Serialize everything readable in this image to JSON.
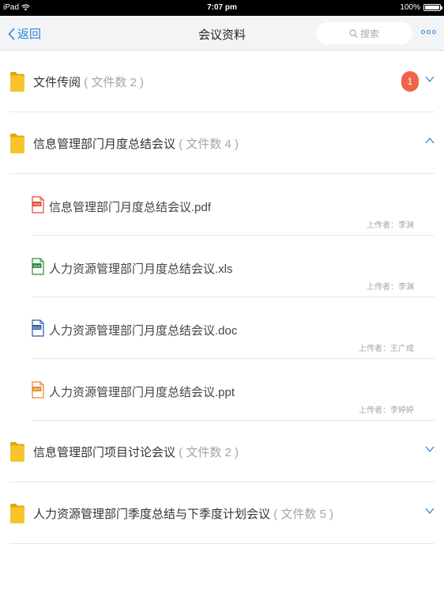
{
  "status_bar": {
    "device": "iPad",
    "time": "7:07 pm",
    "battery": "100%",
    "battery_level": 1.0
  },
  "nav": {
    "back_label": "返回",
    "title": "会议资料",
    "search_placeholder": "搜索"
  },
  "groups": [
    {
      "title": "文件传阅",
      "count": "( 文件数 2 )",
      "badge": "1",
      "expanded": false
    },
    {
      "title": "信息管理部门月度总结会议",
      "count": "( 文件数 4 )",
      "expanded": true
    },
    {
      "title": "信息管理部门项目讨论会议",
      "count": "( 文件数 2 )",
      "expanded": false
    },
    {
      "title": "人力资源管理部门季度总结与下季度计划会议",
      "count": "( 文件数 5 )",
      "expanded": false
    }
  ],
  "files": [
    {
      "name": "信息管理部门月度总结会议.pdf",
      "uploader": "上传者：李渊",
      "type_label": "PDF",
      "color": "#e2483a"
    },
    {
      "name": "人力资源管理部门月度总结会议.xls",
      "uploader": "上传者：李渊",
      "type_label": "XLS",
      "color": "#2e8b3e"
    },
    {
      "name": "人力资源管理部门月度总结会议.doc",
      "uploader": "上传者：王广成",
      "type_label": "DOC",
      "color": "#2c5aa8"
    },
    {
      "name": "人力资源管理部门月度总结会议.ppt",
      "uploader": "上传者：李婷婷",
      "type_label": "PPT",
      "color": "#e8862a"
    }
  ],
  "colors": {
    "accent": "#2b86d9",
    "badge": "#f0644a",
    "folder": "#f7c52b"
  }
}
